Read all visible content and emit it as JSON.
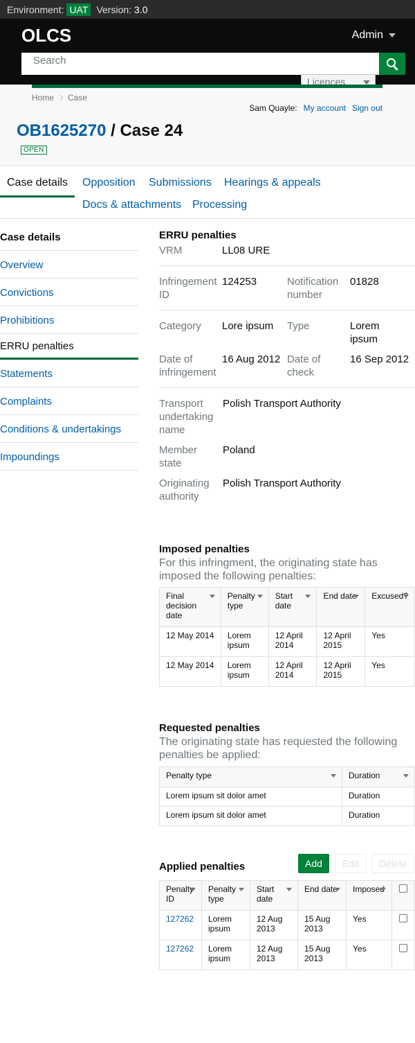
{
  "env": {
    "label": "Environment:",
    "badge": "UAT",
    "version_label": "Version:",
    "version": "3.0"
  },
  "header": {
    "logo": "OLCS",
    "admin": "Admin",
    "search_placeholder": "Search",
    "search_type": "Licences"
  },
  "breadcrumb": {
    "home": "Home",
    "current": "Case"
  },
  "user": {
    "name": "Sam Quayle:",
    "my_account": "My account",
    "sign_out": "Sign out"
  },
  "case": {
    "licence": "OB1625270",
    "separator": "/",
    "case_label": "Case 24",
    "status": "OPEN"
  },
  "tabs": [
    "Case details",
    "Opposition",
    "Submissions",
    "Hearings & appeals",
    "Docs & attachments",
    "Processing"
  ],
  "sidenav": {
    "heading": "Case details",
    "items": [
      "Overview",
      "Convictions",
      "Prohibitions",
      "ERRU penalties",
      "Statements",
      "Complaints",
      "Conditions & undertakings",
      "Impoundings"
    ]
  },
  "erru": {
    "title": "ERRU penalties",
    "vrm_label": "VRM",
    "vrm": "LL08 URE",
    "infringement_id_label": "Infringement ID",
    "infringement_id": "124253",
    "notification_label": "Notification number",
    "notification": "01828",
    "category_label": "Category",
    "category": "Lore ipsum",
    "type_label": "Type",
    "type": "Lorem ipsum",
    "date_infringement_label": "Date of infringement",
    "date_infringement": "16 Aug 2012",
    "date_check_label": "Date of check",
    "date_check": "16 Sep 2012",
    "transport_label": "Transport undertaking name",
    "transport": "Polish Transport Authority",
    "member_state_label": "Member state",
    "member_state": "Poland",
    "originating_label": "Originating authority",
    "originating": "Polish Transport Authority"
  },
  "imposed": {
    "title": "Imposed penalties",
    "subtitle": "For this infringment, the originating state has imposed the following penalties:",
    "headers": [
      "Final decision date",
      "Penalty type",
      "Start date",
      "End date",
      "Excused?"
    ],
    "rows": [
      [
        "12 May 2014",
        "Lorem ipsum",
        "12 April 2014",
        "12 April 2015",
        "Yes"
      ],
      [
        "12 May 2014",
        "Lorem ipsum",
        "12 April 2014",
        "12 April 2015",
        "Yes"
      ]
    ]
  },
  "requested": {
    "title": "Requested penalties",
    "subtitle": "The originating state has requested the following penalties be applied:",
    "headers": [
      "Penalty type",
      "Duration"
    ],
    "rows": [
      [
        "Lorem ipsum sit dolor amet",
        "Duration"
      ],
      [
        "Lorem ipsum sit dolor amet",
        "Duration"
      ]
    ]
  },
  "applied": {
    "title": "Applied penalties",
    "add": "Add",
    "edit": "Edit",
    "delete": "Delete",
    "headers": [
      "Penalty ID",
      "Penalty type",
      "Start date",
      "End date",
      "Imposed"
    ],
    "rows": [
      [
        "127262",
        "Lorem ipsum",
        "12 Aug 2013",
        "15 Aug 2013",
        "Yes"
      ],
      [
        "127262",
        "Lorem ipsum",
        "12 Aug 2013",
        "15 Aug 2013",
        "Yes"
      ]
    ]
  }
}
